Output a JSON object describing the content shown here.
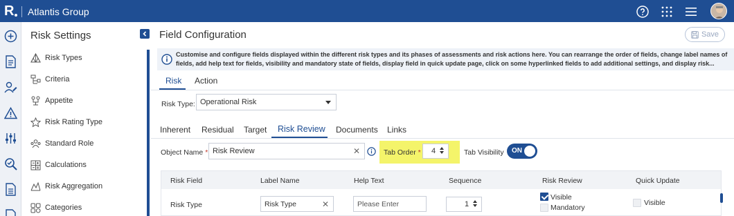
{
  "app": {
    "logo": "R",
    "title": "Atlantis Group"
  },
  "sidebar": {
    "title": "Risk Settings",
    "items": [
      {
        "label": "Risk Types",
        "icon": "risk-types-icon"
      },
      {
        "label": "Criteria",
        "icon": "criteria-icon"
      },
      {
        "label": "Appetite",
        "icon": "appetite-icon"
      },
      {
        "label": "Risk Rating Type",
        "icon": "star-icon"
      },
      {
        "label": "Standard Role",
        "icon": "user-group-icon"
      },
      {
        "label": "Calculations",
        "icon": "calculator-icon"
      },
      {
        "label": "Risk Aggregation",
        "icon": "aggregation-icon"
      },
      {
        "label": "Categories",
        "icon": "categories-icon"
      }
    ]
  },
  "main": {
    "title": "Field Configuration",
    "save_label": "Save",
    "info": "Customise and configure fields displayed within the different risk types and its phases of assessments and risk actions here. You can rearrange the order of fields, change label names of fields, add help text for fields, visibility and mandatory state of fields, display field in quick update page, click on some hyperlinked fields to add additional settings, and display risk...",
    "top_tabs": [
      "Risk",
      "Action"
    ],
    "risk_type_label": "Risk Type:",
    "risk_type_value": "Operational Risk",
    "phase_tabs": [
      "Inherent",
      "Residual",
      "Target",
      "Risk Review",
      "Documents",
      "Links"
    ],
    "object_name_label": "Object Name",
    "object_name_value": "Risk Review",
    "tab_order_label": "Tab Order",
    "tab_order_value": "4",
    "tab_visibility_label": "Tab Visibility",
    "tab_visibility_value": "ON",
    "table": {
      "headers": [
        "Risk Field",
        "Label Name",
        "Help Text",
        "Sequence",
        "Risk Review",
        "Quick Update"
      ],
      "rows": [
        {
          "risk_field": "Risk Type",
          "label_name": "Risk Type",
          "help_text_placeholder": "Please Enter",
          "sequence": "1",
          "visible_label": "Visible",
          "mandatory_label": "Mandatory",
          "quick_update_label": "Visible"
        }
      ]
    }
  },
  "colors": {
    "brand": "#1f4e93",
    "highlight": "#f4f46a",
    "required": "#c0392b"
  }
}
